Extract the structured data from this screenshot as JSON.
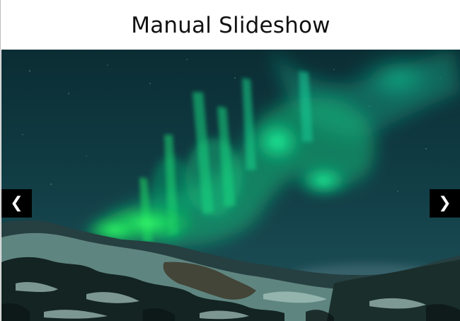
{
  "header": {
    "title": "Manual Slideshow"
  },
  "slideshow": {
    "image_subject": "aurora-borealis-over-snowy-mountains",
    "prev_label": "❮",
    "next_label": "❯"
  },
  "colors": {
    "sky_top": "#0c3036",
    "sky_mid": "#123f48",
    "aurora_bright": "#1ee36b",
    "aurora_teal": "#0fd894",
    "mountain_dark": "#10201f",
    "snow": "#7fa39c",
    "button_bg": "#000000",
    "button_fg": "#ffffff"
  }
}
